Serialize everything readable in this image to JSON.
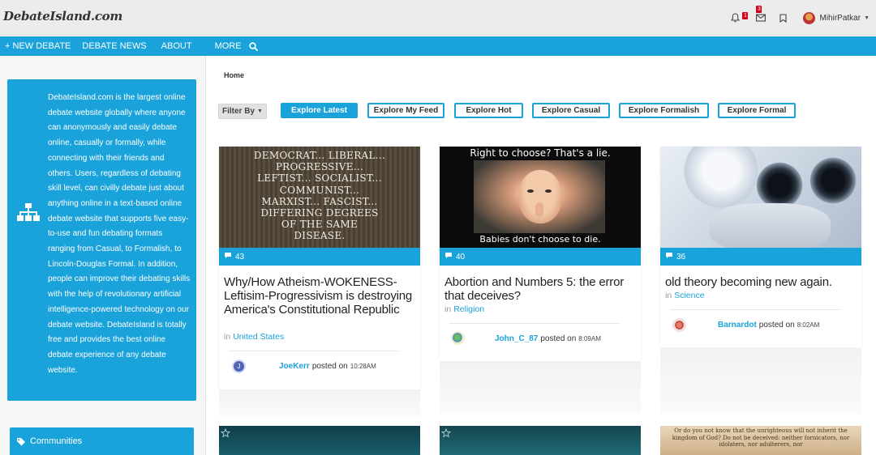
{
  "header": {
    "logo": "DebateIsland.com",
    "notification_badge": "1",
    "message_badge": "3",
    "username": "MihirPatkar",
    "colors": {
      "accent": "#1aa2db",
      "badge": "#d0021b"
    }
  },
  "nav": {
    "items": [
      "+ NEW DEBATE",
      "DEBATE NEWS",
      "ABOUT",
      "MORE"
    ]
  },
  "sidebar": {
    "about_text": "DebateIsland.com is the largest online debate website globally where anyone can anonymously and easily debate online, casually or formally, while connecting with their friends and others. Users, regardless of debating skill level, can civilly debate just about anything online in a text-based online debate website that supports five easy-to-use and fun debating formats ranging from Casual, to Formalish, to Lincoln-Douglas Formal. In addition, people can improve their debating skills with the help of revolutionary artificial intelligence-powered technology on our debate website. DebateIsland is totally free and provides the best online debate experience of any debate website.",
    "communities_label": "Communities"
  },
  "main": {
    "breadcrumb": "Home",
    "filter_by": "Filter By",
    "explore": [
      "Explore Latest",
      "Explore My Feed",
      "Explore Hot",
      "Explore Casual",
      "Explore Formalish",
      "Explore Formal"
    ]
  },
  "cards": [
    {
      "image_text": [
        "DEMOCRAT... LIBERAL...",
        "PROGRESSIVE...",
        "LEFTIST... SOCIALIST...",
        "COMMUNIST...",
        "MARXIST... FASCIST...",
        "DIFFERING DEGREES",
        "OF THE SAME",
        "DISEASE."
      ],
      "comments": "43",
      "title": "Why/How Atheism-WOKENESS-Leftisim-Progressivism is destroying America's Constitutional Republic",
      "in": "in",
      "category": "United States",
      "avatar_letter": "J",
      "author": "JoeKerr",
      "posted_on": "posted on",
      "time": "10:28AM"
    },
    {
      "image_text_top": "Right to choose? That's a lie.",
      "image_text_bottom": "Babies don't choose to die.",
      "comments": "40",
      "title": "Abortion and Numbers 5: the error that deceives?",
      "in": "in",
      "category": "Religion",
      "author": "John_C_87",
      "posted_on": "posted on",
      "time": "8:09AM"
    },
    {
      "comments": "36",
      "title": "old theory becoming new again.",
      "in": "in",
      "category": "Science",
      "author": "Barnardot",
      "posted_on": "posted on",
      "time": "8:02AM"
    }
  ],
  "bottom_cards": [
    {
      "image_text": ""
    },
    {
      "image_text": ""
    },
    {
      "image_text": "Or do you not know that the unrighteous will not inherit the kingdom of God? Do not be deceived: neither fornicators, nor idolaters, nor adulterers, nor"
    }
  ]
}
